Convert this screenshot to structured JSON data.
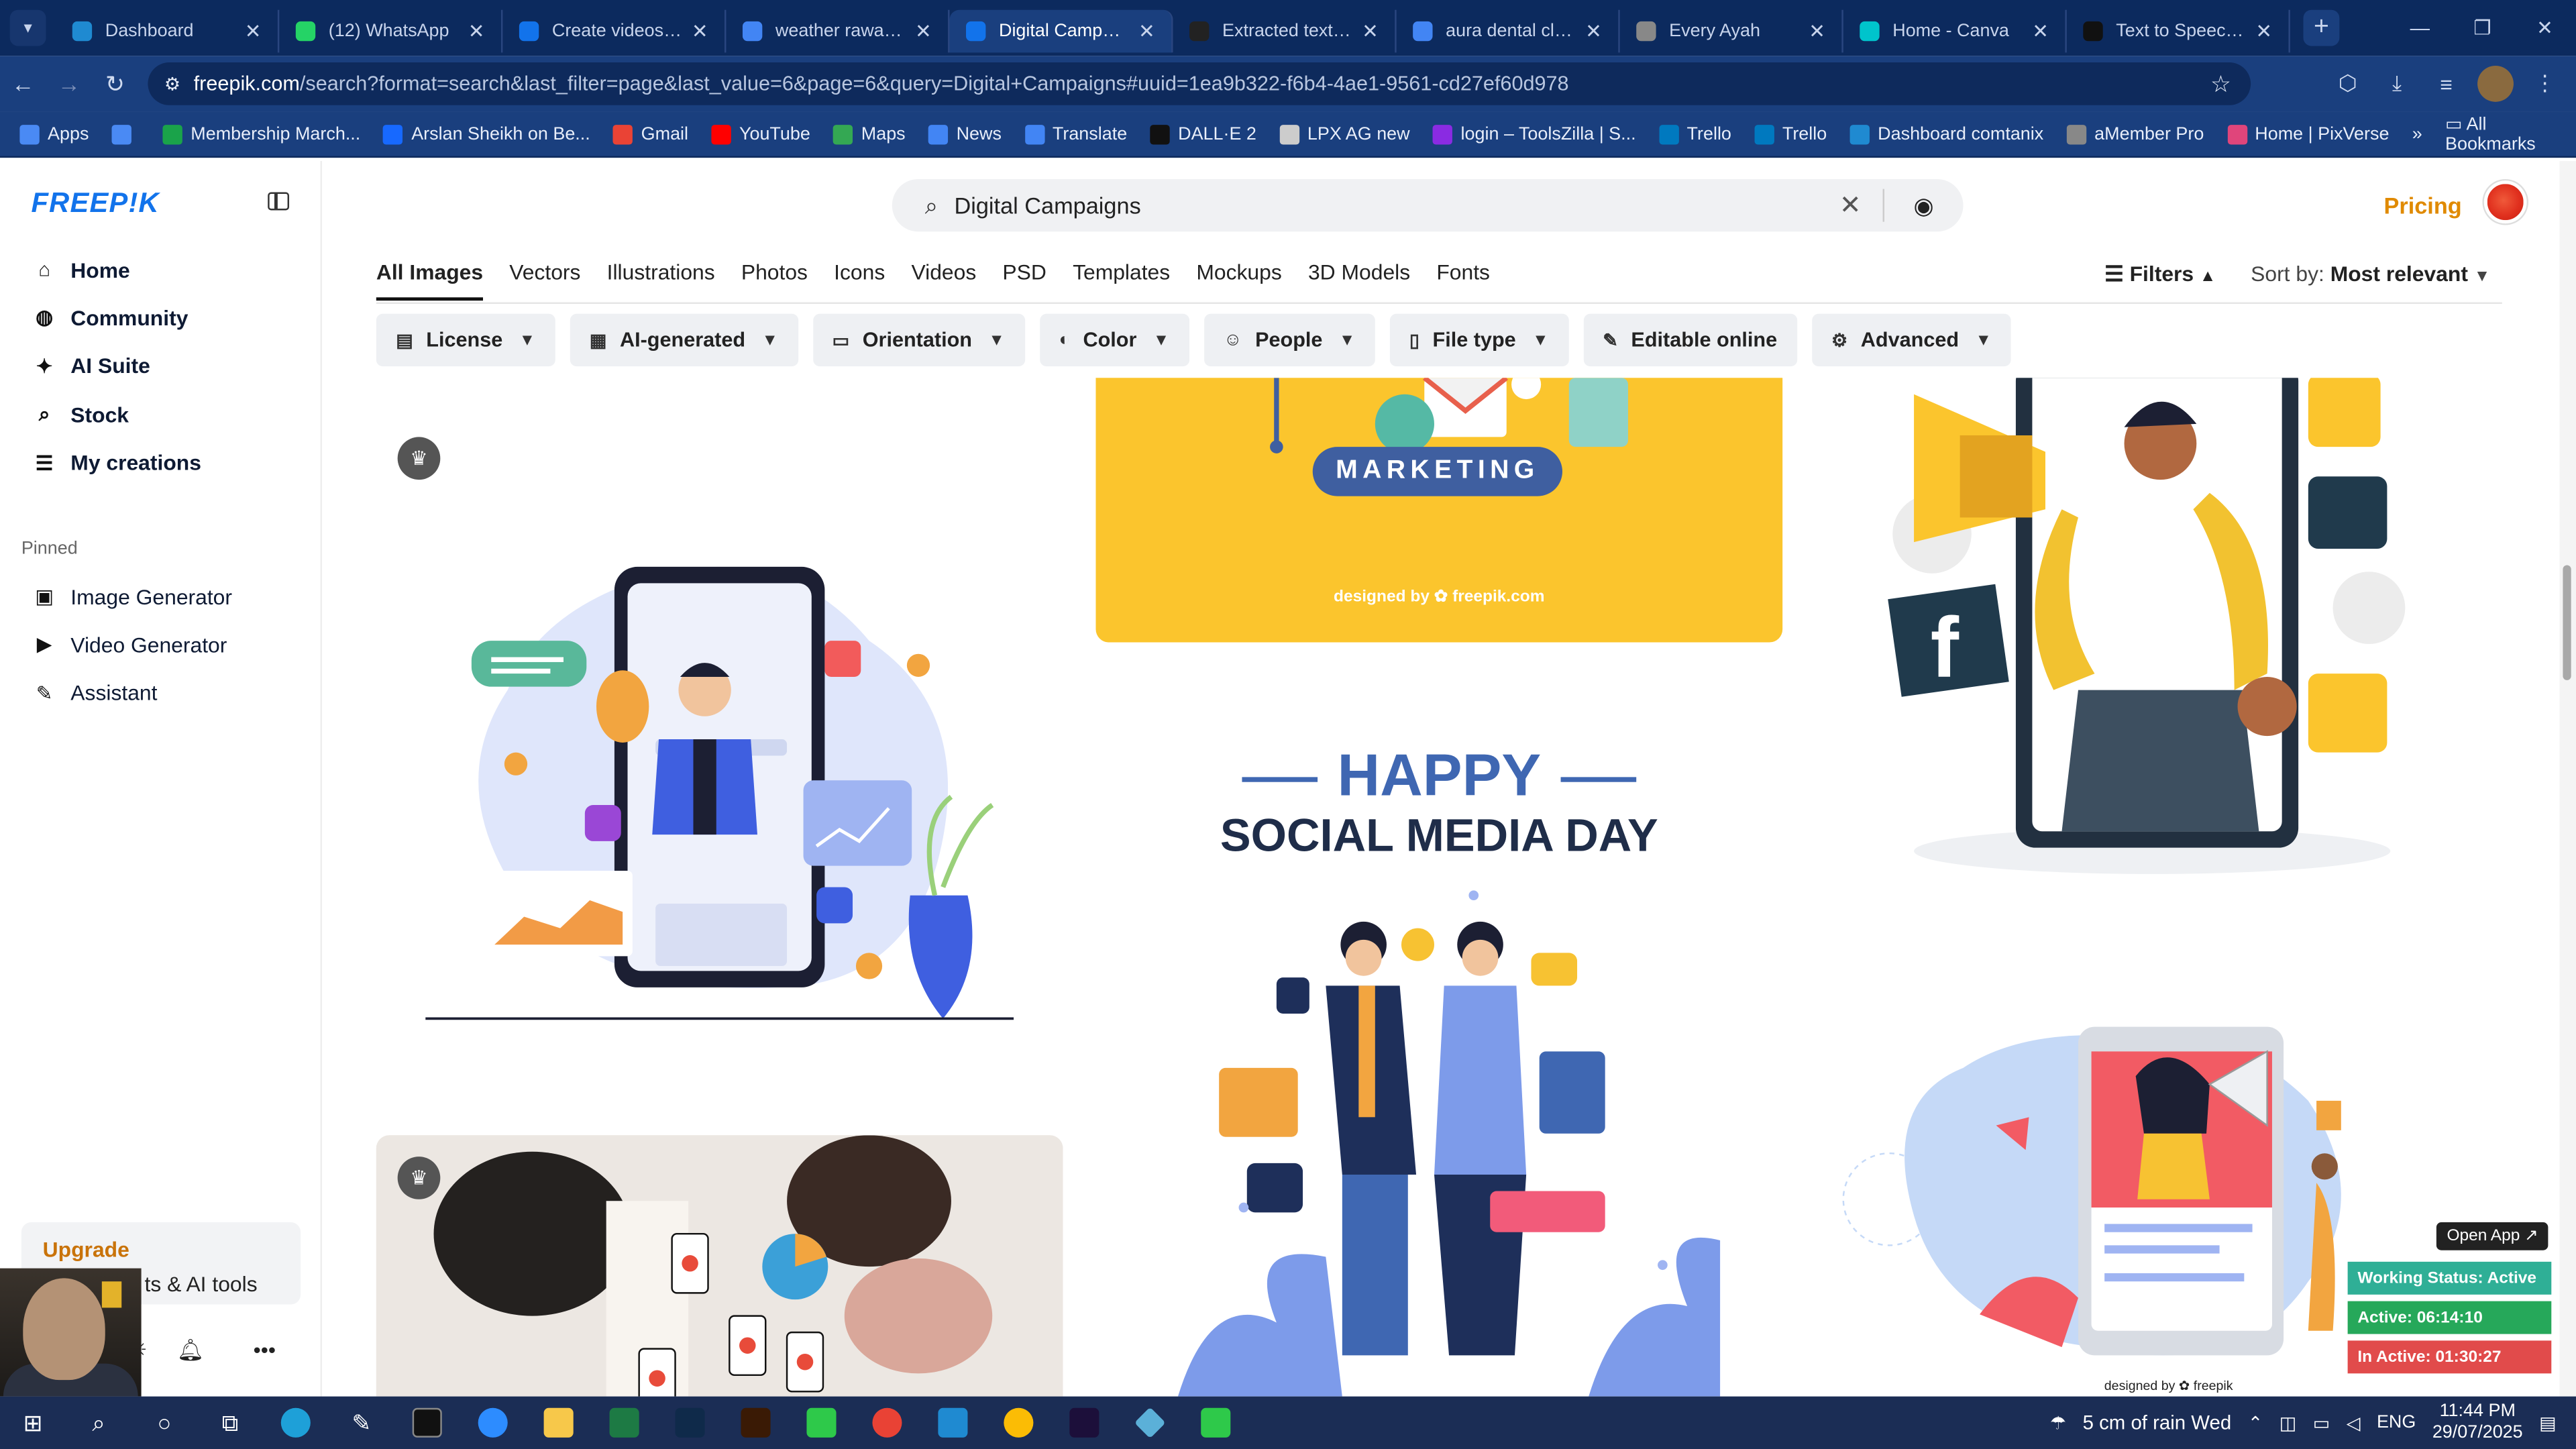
{
  "browser": {
    "tabs": [
      {
        "title": "Dashboard",
        "color": "#1f8ad1"
      },
      {
        "title": "(12) WhatsApp",
        "color": "#25d366"
      },
      {
        "title": "Create videos | Fr",
        "color": "#1273eb"
      },
      {
        "title": "weather rawalpin",
        "color": "#4285f4"
      },
      {
        "title": "Digital Campaign",
        "color": "#1273eb"
      },
      {
        "title": "Extracted text sum",
        "color": "#222222"
      },
      {
        "title": "aura dental clinic",
        "color": "#4285f4"
      },
      {
        "title": "Every Ayah",
        "color": "#888888"
      },
      {
        "title": "Home - Canva",
        "color": "#00c4cc"
      },
      {
        "title": "Text to Speech | E",
        "color": "#111111"
      }
    ],
    "url_domain": "freepik.com",
    "url_rest": "/search?format=search&last_filter=page&last_value=6&page=6&query=Digital+Campaigns#uuid=1ea9b322-f6b4-4ae1-9561-cd27ef60d978",
    "bookmarks": [
      {
        "label": "Apps",
        "color": "#4a8af4"
      },
      {
        "label": "",
        "color": "#4a8af4"
      },
      {
        "label": "Membership March...",
        "color": "#1aa34a"
      },
      {
        "label": "Arslan Sheikh on Be...",
        "color": "#1769ff"
      },
      {
        "label": "Gmail",
        "color": "#ea4335"
      },
      {
        "label": "YouTube",
        "color": "#ff0000"
      },
      {
        "label": "Maps",
        "color": "#34a853"
      },
      {
        "label": "News",
        "color": "#4285f4"
      },
      {
        "label": "Translate",
        "color": "#4285f4"
      },
      {
        "label": "DALL·E 2",
        "color": "#111111"
      },
      {
        "label": "LPX AG new",
        "color": "#cccccc"
      },
      {
        "label": "login – ToolsZilla | S...",
        "color": "#8a2be2"
      },
      {
        "label": "Trello",
        "color": "#0079bf"
      },
      {
        "label": "Trello",
        "color": "#0079bf"
      },
      {
        "label": "Dashboard comtanix",
        "color": "#1f8ad1"
      },
      {
        "label": "aMember Pro",
        "color": "#888888"
      },
      {
        "label": "Home | PixVerse",
        "color": "#e0457b"
      }
    ],
    "all_bookmarks": "All Bookmarks"
  },
  "sidebar": {
    "logo": "FREEP!K",
    "nav": [
      {
        "label": "Home",
        "icon": "⌂"
      },
      {
        "label": "Community",
        "icon": "◍"
      },
      {
        "label": "AI Suite",
        "icon": "✦"
      },
      {
        "label": "Stock",
        "icon": "⌕"
      },
      {
        "label": "My creations",
        "icon": "☰"
      }
    ],
    "pinned_label": "Pinned",
    "pinned": [
      {
        "label": "Image Generator",
        "icon": "▣"
      },
      {
        "label": "Video Generator",
        "icon": "▶"
      },
      {
        "label": "Assistant",
        "icon": "✎"
      }
    ],
    "upgrade": "Upgrade",
    "upgrade_sub": "ts & AI tools"
  },
  "search": {
    "value": "Digital Campaigns",
    "pricing": "Pricing"
  },
  "content_tabs": [
    "All Images",
    "Vectors",
    "Illustrations",
    "Photos",
    "Icons",
    "Videos",
    "PSD",
    "Templates",
    "Mockups",
    "3D Models",
    "Fonts"
  ],
  "filters_label": "Filters",
  "sort_label": "Sort by:",
  "sort_value": "Most relevant",
  "filter_chips": [
    {
      "label": "License",
      "icon": "▤"
    },
    {
      "label": "AI-generated",
      "icon": "▦"
    },
    {
      "label": "Orientation",
      "icon": "▭"
    },
    {
      "label": "Color",
      "icon": "◐"
    },
    {
      "label": "People",
      "icon": "☺"
    },
    {
      "label": "File type",
      "icon": "▯"
    },
    {
      "label": "Editable online",
      "icon": "✎"
    },
    {
      "label": "Advanced",
      "icon": "⚙"
    }
  ],
  "cards": {
    "marketing_text": "MARKETING",
    "designed_by": "designed by ✿ freepik.com",
    "happy": "HAPPY",
    "social_media_day": "SOCIAL MEDIA DAY",
    "designed_by_2": "designed by ✿ freepik"
  },
  "widget": {
    "open_app": "Open App ↗",
    "status": "Working Status: Active",
    "active": "Active: 06:14:10",
    "inactive": "In Active: 01:30:27"
  },
  "taskbar": {
    "weather": "5 cm of rain Wed",
    "lang": "ENG",
    "time": "11:44 PM",
    "date": "29/07/2025"
  }
}
